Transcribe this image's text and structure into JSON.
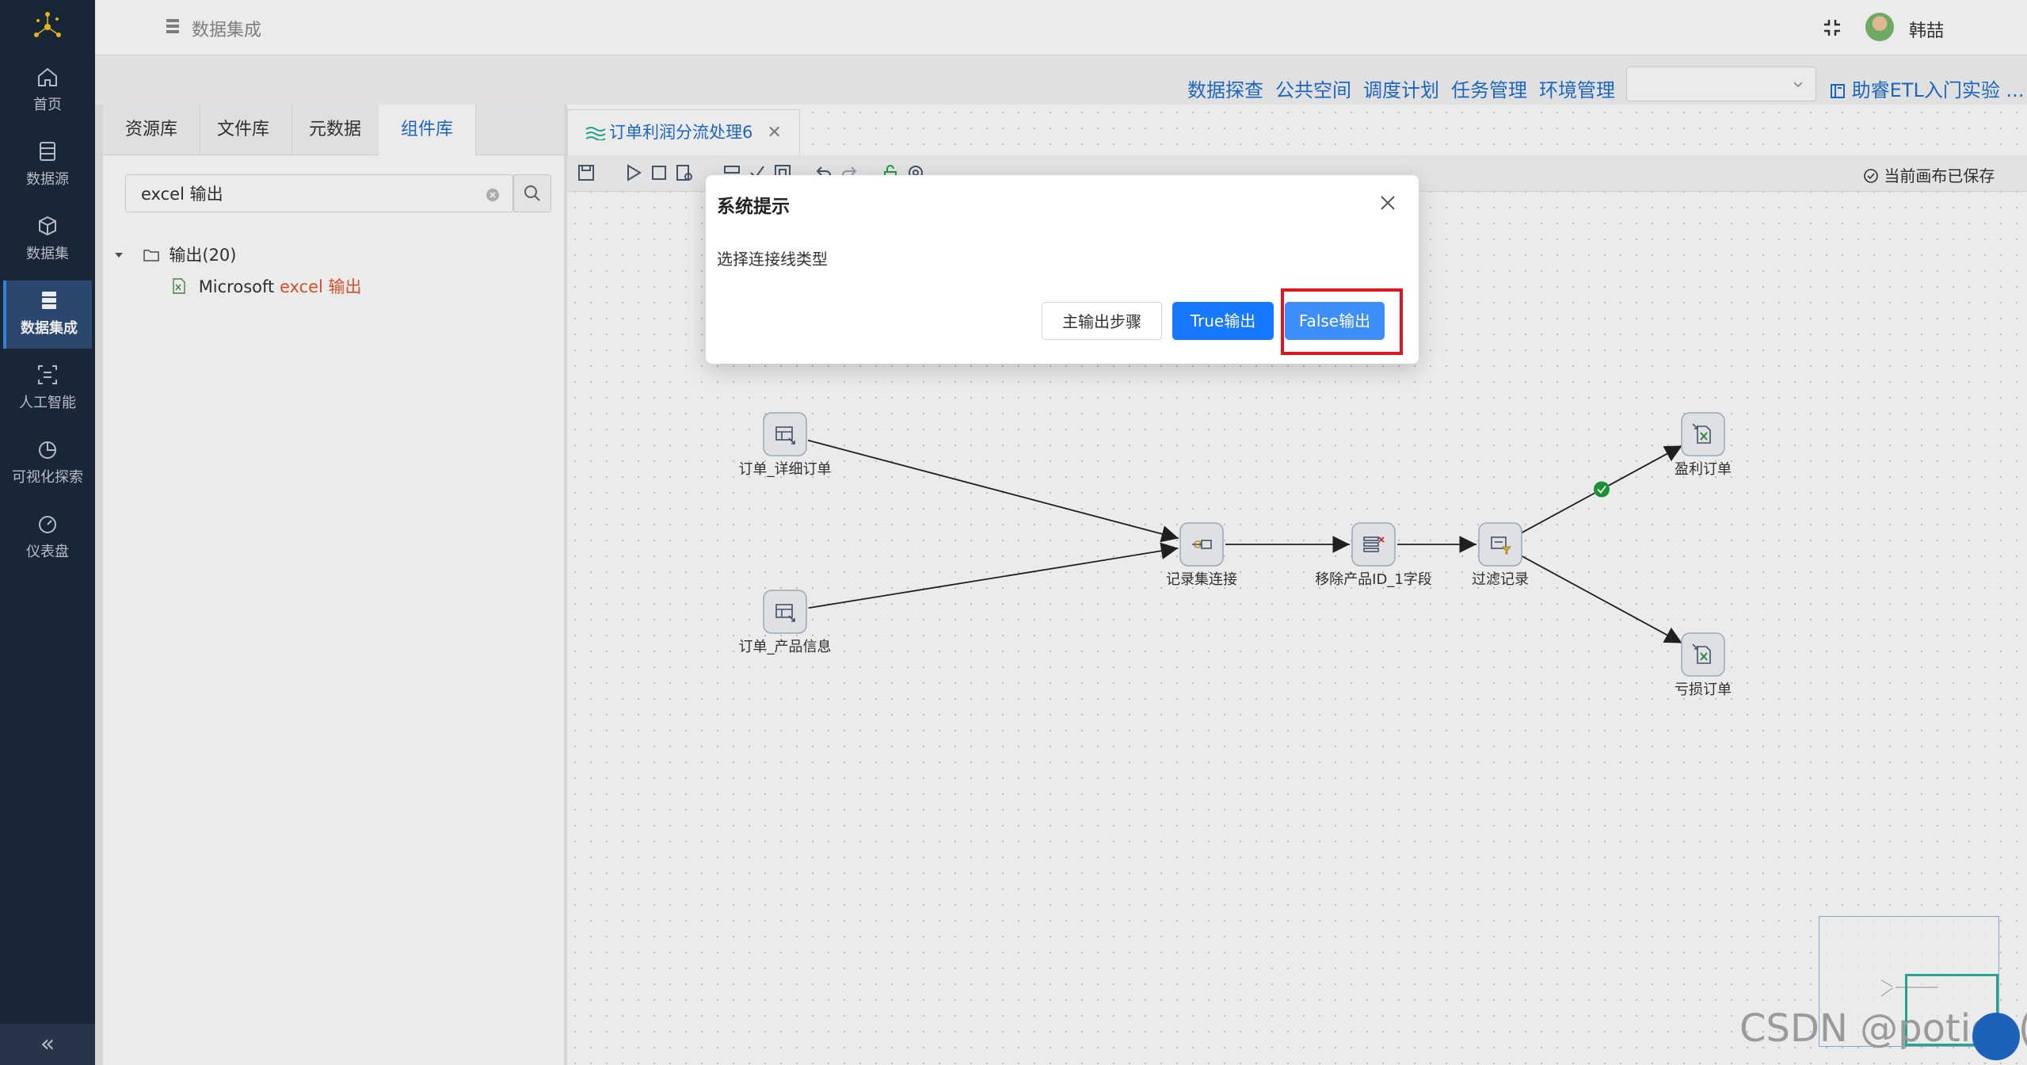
{
  "sidebar": {
    "items": [
      {
        "label": "首页",
        "icon": "home-icon"
      },
      {
        "label": "数据源",
        "icon": "database-icon"
      },
      {
        "label": "数据集",
        "icon": "cube-icon"
      },
      {
        "label": "数据集成",
        "icon": "integration-icon",
        "active": true
      },
      {
        "label": "人工智能",
        "icon": "ai-icon"
      },
      {
        "label": "可视化探索",
        "icon": "pie-chart-icon"
      },
      {
        "label": "仪表盘",
        "icon": "dashboard-icon"
      }
    ],
    "collapse_label": "«"
  },
  "header": {
    "breadcrumb": "数据集成",
    "username": "韩喆"
  },
  "topbar": {
    "links": [
      "数据探查",
      "公共空间",
      "调度计划",
      "任务管理",
      "环境管理"
    ],
    "env_select_value": "",
    "guide_link": "助睿ETL入门实验 ..."
  },
  "left_panel": {
    "tabs": [
      "资源库",
      "文件库",
      "元数据",
      "组件库"
    ],
    "active_tab": "组件库",
    "search_value": "excel 输出",
    "tree": {
      "folder": "输出(20)",
      "item_prefix": "Microsoft ",
      "item_highlight": "excel 输出"
    }
  },
  "canvas": {
    "tab_title": "订单利润分流处理6",
    "tab_close": "✕",
    "save_status": "当前画布已保存",
    "nodes": [
      {
        "id": "n1",
        "label": "订单_详细订单",
        "type": "table-input"
      },
      {
        "id": "n2",
        "label": "订单_产品信息",
        "type": "table-input"
      },
      {
        "id": "n3",
        "label": "记录集连接",
        "type": "merge-join"
      },
      {
        "id": "n4",
        "label": "移除产品ID_1字段",
        "type": "select-values"
      },
      {
        "id": "n5",
        "label": "过滤记录",
        "type": "filter"
      },
      {
        "id": "n6",
        "label": "盈利订单",
        "type": "excel-output"
      },
      {
        "id": "n7",
        "label": "亏损订单",
        "type": "excel-output"
      }
    ],
    "edges": [
      {
        "from": "n1",
        "to": "n3"
      },
      {
        "from": "n2",
        "to": "n3"
      },
      {
        "from": "n3",
        "to": "n4"
      },
      {
        "from": "n4",
        "to": "n5"
      },
      {
        "from": "n5",
        "to": "n6",
        "status": "true"
      },
      {
        "from": "n5",
        "to": "n7"
      }
    ]
  },
  "dialog": {
    "title": "系统提示",
    "message": "选择连接线类型",
    "buttons": {
      "main": "主输出步骤",
      "true": "True输出",
      "false": "False输出"
    }
  },
  "watermark": "CSDN @potion()",
  "colors": {
    "sidebar_bg": "#1b2a3d",
    "accent": "#1677ff",
    "link": "#1f6fd1",
    "highlight": "#e0161f",
    "search_hit": "#e4572e"
  }
}
